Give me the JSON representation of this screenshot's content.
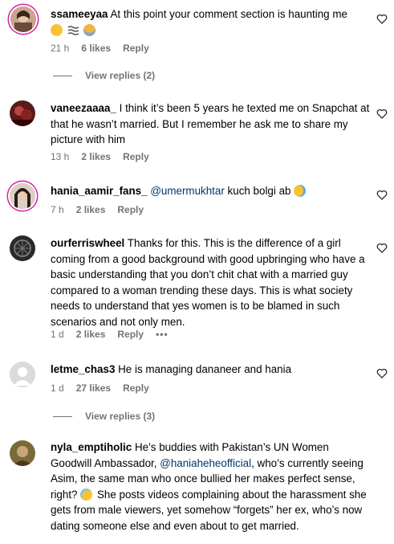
{
  "comments": [
    {
      "username": "ssameeyaa",
      "text": "At this point your comment section is haunting me",
      "emojis": [
        "grimacing-face",
        "fog",
        "screaming-face"
      ],
      "time": "21 h",
      "likes": "6 likes",
      "reply": "Reply",
      "view_replies": "View replies (2)"
    },
    {
      "username": "vaneezaaaa_",
      "text": "I think it’s been 5 years he texted me on Snapchat at that he wasn’t married. But I remember he ask me to share my picture with him",
      "time": "13 h",
      "likes": "2 likes",
      "reply": "Reply"
    },
    {
      "username": "hania_aamir_fans_",
      "mention": "@umermukhtar",
      "text": "kuch bolgi ab",
      "emojis": [
        "crying-face"
      ],
      "time": "7 h",
      "likes": "2 likes",
      "reply": "Reply"
    },
    {
      "username": "ourferriswheel",
      "text": "Thanks for this. This is the difference of a girl coming from a good background with good upbringing who have a basic understanding that you don’t chit chat with a married guy compared to a woman trending these days. This is what society needs to understand that yes women is to be blamed in such scenarios and not only men.",
      "time": "1 d",
      "likes": "2 likes",
      "reply": "Reply",
      "more": "•••"
    },
    {
      "username": "letme_chas3",
      "text": "He is managing dananeer and hania",
      "time": "1 d",
      "likes": "27 likes",
      "reply": "Reply",
      "view_replies": "View replies (3)"
    },
    {
      "username": "nyla_emptiholic",
      "text_before": "He’s buddies with Pakistan’s UN Women Goodwill Ambassador,",
      "mention": "@haniaheheofficial",
      "text_after": ", who’s currently seeing Asim, the same man who once bullied her makes perfect sense, right?",
      "emoji_mid": "grinning-sweat-face",
      "text_end": "She posts videos complaining about the harassment she gets from male viewers, yet somehow “forgets” her ex, who’s now dating someone else and even about to get married."
    }
  ],
  "colors": {
    "meta": "#737373",
    "mention": "#00376b",
    "story_ring": "#d6249f"
  }
}
